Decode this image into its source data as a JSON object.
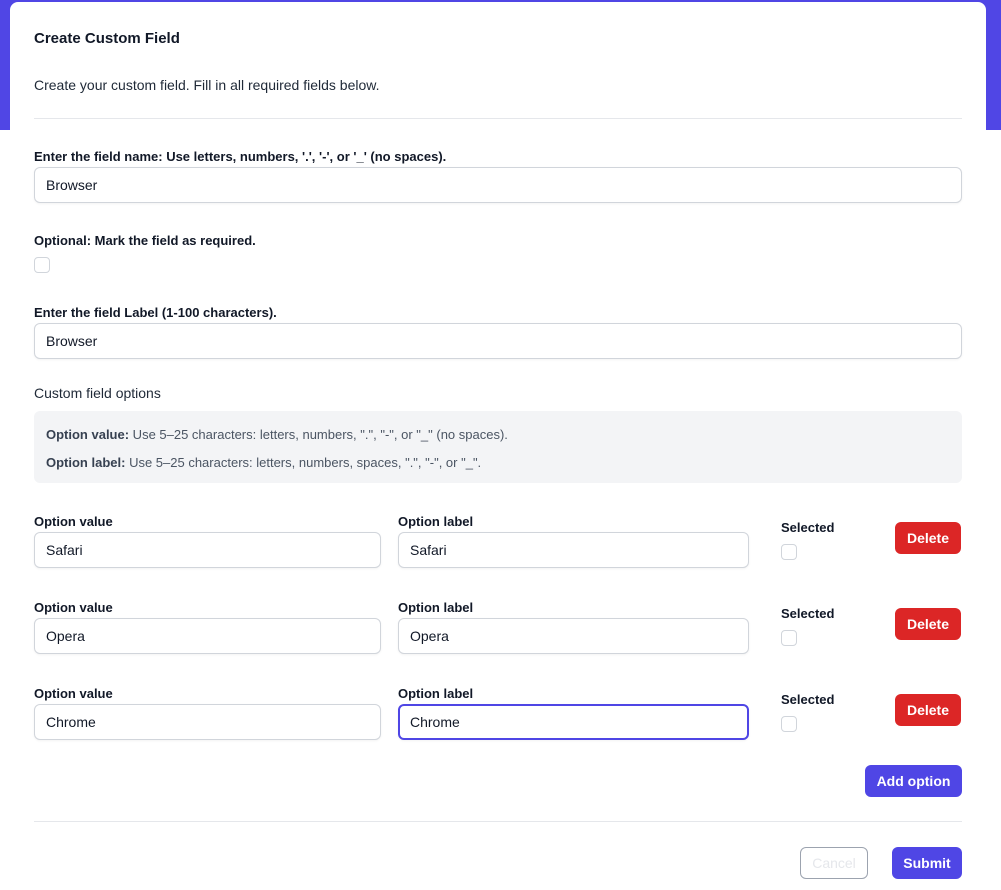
{
  "modal": {
    "title": "Create Custom Field",
    "subtitle": "Create your custom field. Fill in all required fields below."
  },
  "form": {
    "name_label": "Enter the field name: Use letters, numbers, '.', '-', or '_' (no spaces).",
    "name_value": "Browser",
    "required_label": "Optional: Mark the field as required.",
    "required_checked": false,
    "label_label": "Enter the field Label (1-100 characters).",
    "label_value": "Browser",
    "options_section_label": "Custom field options",
    "info": {
      "value_key": "Option value:",
      "value_text": " Use 5–25 characters: letters, numbers, \".\", \"-\", or \"_\" (no spaces).",
      "label_key": "Option label:",
      "label_text": " Use 5–25 characters: letters, numbers, spaces, \".\", \"-\", or \"_\"."
    },
    "option_value_header": "Option value",
    "option_label_header": "Option label",
    "selected_header": "Selected",
    "delete_label": "Delete",
    "options": [
      {
        "value": "Safari",
        "label": "Safari",
        "selected": false
      },
      {
        "value": "Opera",
        "label": "Opera",
        "selected": false
      },
      {
        "value": "Chrome",
        "label": "Chrome",
        "selected": false
      }
    ],
    "add_option_label": "Add option"
  },
  "footer": {
    "cancel_label": "Cancel",
    "submit_label": "Submit"
  },
  "colors": {
    "accent": "#4f46e5",
    "danger": "#dc2626",
    "band": "#5046e5"
  }
}
